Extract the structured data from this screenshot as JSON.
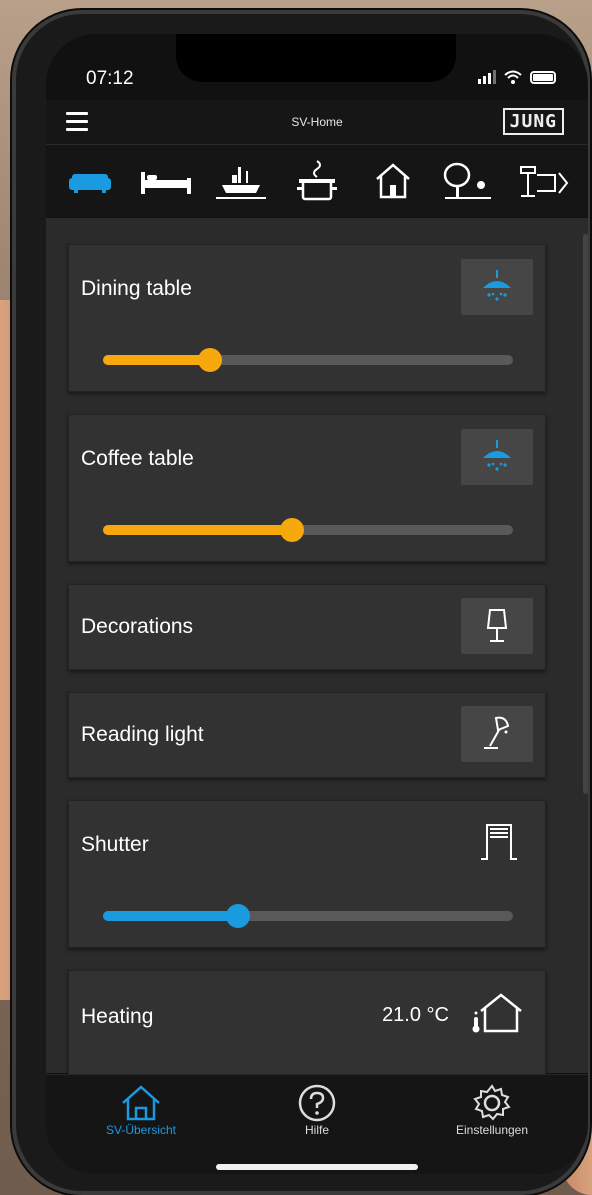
{
  "status": {
    "time": "07:12"
  },
  "header": {
    "title": "SV-Home",
    "brand": "JUNG"
  },
  "room_tabs": [
    {
      "icon": "sofa-icon",
      "active": true
    },
    {
      "icon": "bed-icon",
      "active": false
    },
    {
      "icon": "dining-icon",
      "active": false
    },
    {
      "icon": "cooking-pot-icon",
      "active": false
    },
    {
      "icon": "house-icon",
      "active": false
    },
    {
      "icon": "garden-icon",
      "active": false
    },
    {
      "icon": "terrace-icon",
      "active": false
    }
  ],
  "cards": [
    {
      "label": "Dining table",
      "icon": "ceiling-lamp-icon",
      "slider_fraction": 0.26,
      "slider_color": "#f7a80d"
    },
    {
      "label": "Coffee table",
      "icon": "ceiling-lamp-icon",
      "slider_fraction": 0.46,
      "slider_color": "#f7a80d"
    },
    {
      "label": "Decorations",
      "icon": "table-lamp-icon"
    },
    {
      "label": "Reading light",
      "icon": "desk-lamp-icon"
    },
    {
      "label": "Shutter",
      "icon": "shutter-icon",
      "slider_fraction": 0.33,
      "slider_color": "#1a9be0"
    },
    {
      "label": "Heating",
      "icon": "thermostat-house-icon",
      "value": "21.0 °C"
    }
  ],
  "bottom_nav": [
    {
      "label": "SV-Übersicht",
      "icon": "home-icon",
      "active": true
    },
    {
      "label": "Hilfe",
      "icon": "help-icon",
      "active": false
    },
    {
      "label": "Einstellungen",
      "icon": "gear-icon",
      "active": false
    }
  ],
  "colors": {
    "accent": "#1a9be0",
    "dimmer": "#f7a80d",
    "card": "#323232",
    "background": "#2b2b2b"
  }
}
